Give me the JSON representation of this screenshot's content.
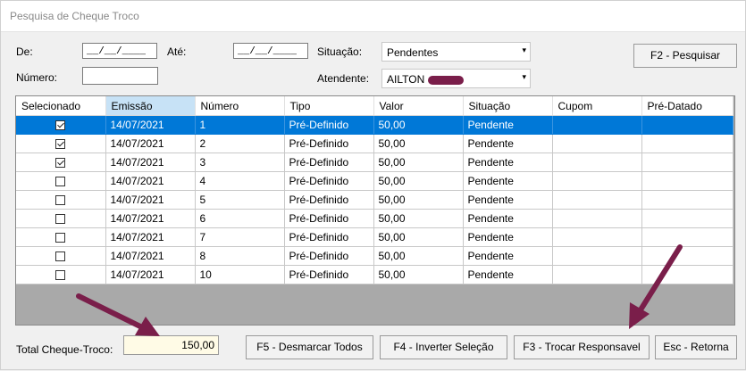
{
  "window": {
    "title": "Pesquisa de Cheque Troco"
  },
  "filters": {
    "de_label": "De:",
    "de_value": "__/__/____",
    "ate_label": "Até:",
    "ate_value": "__/__/____",
    "numero_label": "Número:",
    "numero_value": "",
    "situacao_label": "Situação:",
    "situacao_value": "Pendentes",
    "atendente_label": "Atendente:",
    "atendente_value": "AILTON"
  },
  "buttons": {
    "pesquisar": "F2 - Pesquisar",
    "desmarcar": "F5 - Desmarcar Todos",
    "inverter": "F4 - Inverter Seleção",
    "trocar": "F3 - Trocar Responsavel",
    "retorna": "Esc - Retorna"
  },
  "grid": {
    "columns": [
      "Selecionado",
      "Emissão",
      "Número",
      "Tipo",
      "Valor",
      "Situação",
      "Cupom",
      "Pré-Datado"
    ],
    "rows": [
      {
        "checked": true,
        "emissao": "14/07/2021",
        "numero": "1",
        "tipo": "Pré-Definido",
        "valor": "50,00",
        "situacao": "Pendente",
        "cupom": "",
        "predatado": "",
        "selected": true
      },
      {
        "checked": true,
        "emissao": "14/07/2021",
        "numero": "2",
        "tipo": "Pré-Definido",
        "valor": "50,00",
        "situacao": "Pendente",
        "cupom": "",
        "predatado": "",
        "selected": false
      },
      {
        "checked": true,
        "emissao": "14/07/2021",
        "numero": "3",
        "tipo": "Pré-Definido",
        "valor": "50,00",
        "situacao": "Pendente",
        "cupom": "",
        "predatado": "",
        "selected": false
      },
      {
        "checked": false,
        "emissao": "14/07/2021",
        "numero": "4",
        "tipo": "Pré-Definido",
        "valor": "50,00",
        "situacao": "Pendente",
        "cupom": "",
        "predatado": "",
        "selected": false
      },
      {
        "checked": false,
        "emissao": "14/07/2021",
        "numero": "5",
        "tipo": "Pré-Definido",
        "valor": "50,00",
        "situacao": "Pendente",
        "cupom": "",
        "predatado": "",
        "selected": false
      },
      {
        "checked": false,
        "emissao": "14/07/2021",
        "numero": "6",
        "tipo": "Pré-Definido",
        "valor": "50,00",
        "situacao": "Pendente",
        "cupom": "",
        "predatado": "",
        "selected": false
      },
      {
        "checked": false,
        "emissao": "14/07/2021",
        "numero": "7",
        "tipo": "Pré-Definido",
        "valor": "50,00",
        "situacao": "Pendente",
        "cupom": "",
        "predatado": "",
        "selected": false
      },
      {
        "checked": false,
        "emissao": "14/07/2021",
        "numero": "8",
        "tipo": "Pré-Definido",
        "valor": "50,00",
        "situacao": "Pendente",
        "cupom": "",
        "predatado": "",
        "selected": false
      },
      {
        "checked": false,
        "emissao": "14/07/2021",
        "numero": "10",
        "tipo": "Pré-Definido",
        "valor": "50,00",
        "situacao": "Pendente",
        "cupom": "",
        "predatado": "",
        "selected": false
      }
    ]
  },
  "total": {
    "label": "Total Cheque-Troco:",
    "value": "150,00"
  },
  "colors": {
    "selection": "#0078d7",
    "annotation_arrow": "#7a1e4a",
    "sorted_header": "#c7e2f6",
    "total_bg": "#fffbe6"
  }
}
